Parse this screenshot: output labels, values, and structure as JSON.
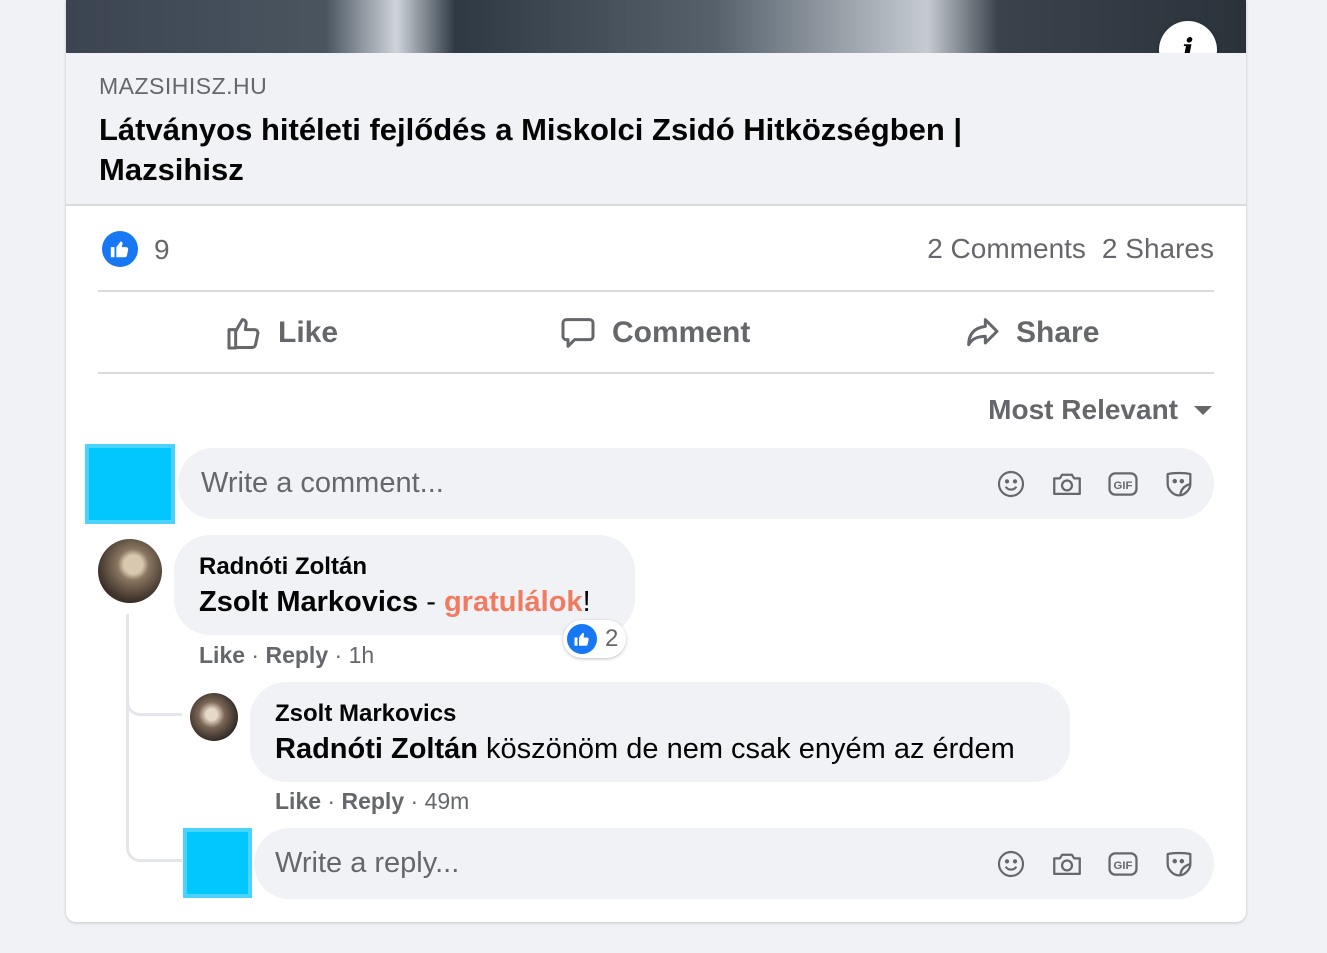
{
  "link": {
    "domain": "MAZSIHISZ.HU",
    "title": "Látványos hitéleti fejlődés a Miskolci Zsidó Hitközségben | Mazsihisz",
    "info_glyph": "i"
  },
  "stats": {
    "likes": "9",
    "comments": "2 Comments",
    "shares": "2 Shares"
  },
  "actions": {
    "like": "Like",
    "comment": "Comment",
    "share": "Share"
  },
  "sort": {
    "label": "Most Relevant"
  },
  "composer": {
    "placeholder": "Write a comment..."
  },
  "comments": [
    {
      "author": "Radnóti Zoltán",
      "text_mention": "Zsolt Markovics",
      "text_sep": " - ",
      "text_highlight": "gratulálok",
      "text_end": "!",
      "reaction_count": "2",
      "like": "Like",
      "reply": "Reply",
      "time": "1h"
    },
    {
      "author": "Zsolt Markovics",
      "text_mention": "Radnóti Zoltán",
      "text_rest": " köszönöm de nem csak enyém az érdem",
      "like": "Like",
      "reply": "Reply",
      "time": "49m"
    }
  ],
  "reply_composer": {
    "placeholder": "Write a reply..."
  },
  "colors": {
    "accent": "#1877f2",
    "highlight": "#f07b60",
    "muted": "#65676b",
    "placeholder_avatar": "#00c8ff"
  }
}
